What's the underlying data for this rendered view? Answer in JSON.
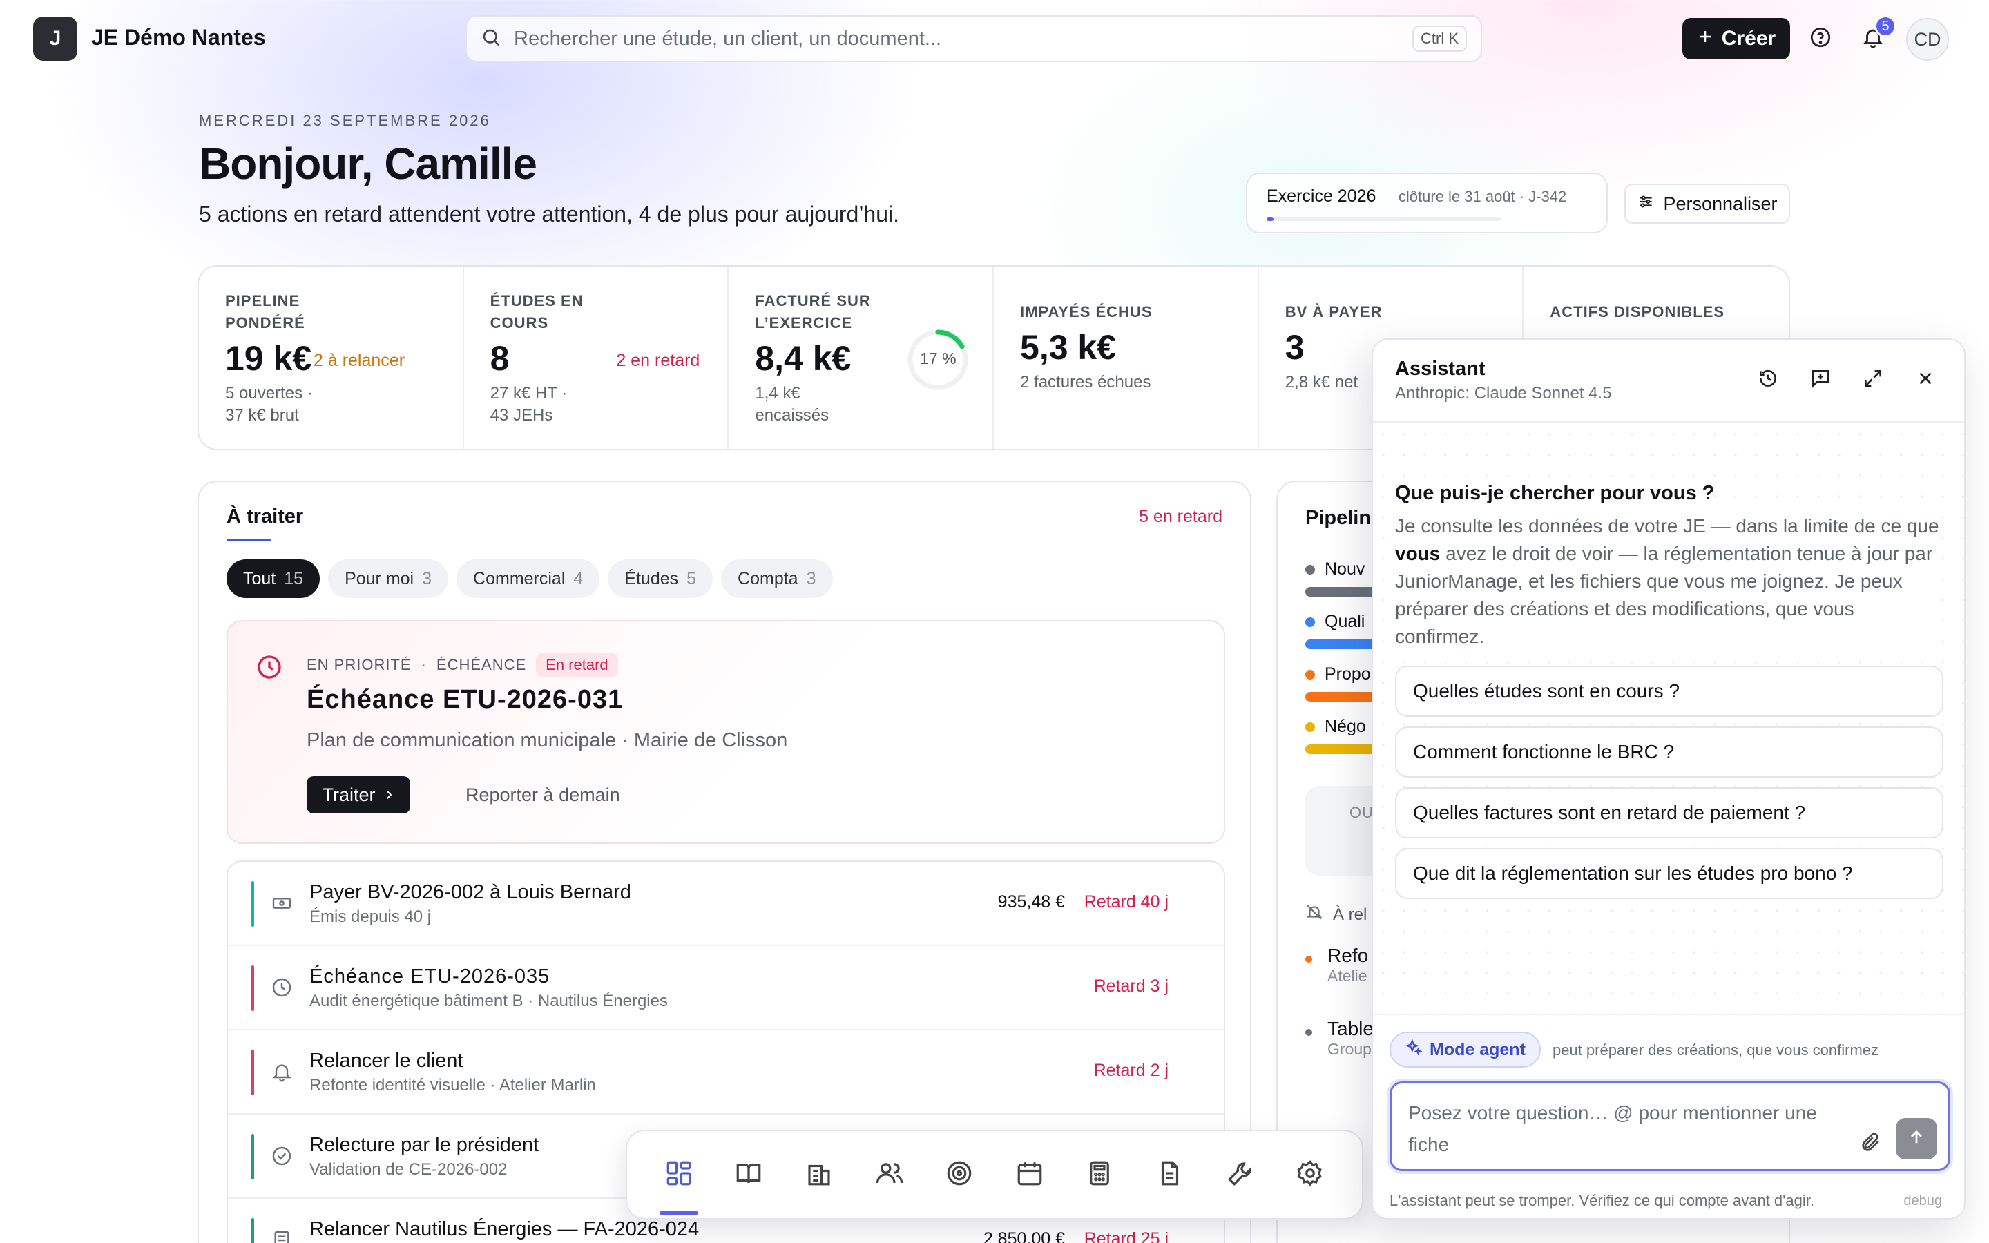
{
  "topbar": {
    "logo_letter": "J",
    "org_name": "JE Démo Nantes",
    "search_placeholder": "Rechercher une étude, un client, un document...",
    "search_shortcut": "Ctrl K",
    "create_label": "Créer",
    "notifications_count": "5",
    "avatar_initials": "CD"
  },
  "header": {
    "date": "MERCREDI 23 SEPTEMBRE 2026",
    "greeting": "Bonjour, Camille",
    "subtitle": "5 actions en retard attendent votre attention, 4 de plus pour aujourd’hui.",
    "exercice_label": "Exercice 2026",
    "exercice_close": "clôture le 31 août · J-342",
    "exercice_progress": 0.03,
    "customize_label": "Personnaliser"
  },
  "kpis": [
    {
      "label": "PIPELINE PONDÉRÉ",
      "value": "19 k€",
      "tag": "2 à relancer",
      "note": "5 ouvertes · 37 k€ brut"
    },
    {
      "label": "ÉTUDES EN COURS",
      "value": "8",
      "tag": "2 en retard",
      "note": "27 k€ HT · 43 JEHs"
    },
    {
      "label": "FACTURÉ SUR L’EXERCICE",
      "value": "8,4 k€",
      "tag": "17 %",
      "note": "1,4 k€ encaissés",
      "progress": 0.17
    },
    {
      "label": "IMPAYÉS ÉCHUS",
      "value": "5,3 k€",
      "tag": "2 factures échues",
      "note": ""
    },
    {
      "label": "BV À PAYER",
      "value": "3",
      "tag": "",
      "note": "2,8 k€ net"
    },
    {
      "label": "ACTIFS DISPONIBLES",
      "value": "",
      "tag": "",
      "note": ""
    }
  ],
  "todo": {
    "title": "À traiter",
    "late": "5 en retard",
    "filters": [
      {
        "label": "Tout",
        "count": "15"
      },
      {
        "label": "Pour moi",
        "count": "3"
      },
      {
        "label": "Commercial",
        "count": "4"
      },
      {
        "label": "Études",
        "count": "5"
      },
      {
        "label": "Compta",
        "count": "3"
      }
    ],
    "priority": {
      "kicker1": "EN PRIORITÉ",
      "kicker2": "ÉCHÉANCE",
      "chip": "En retard",
      "title": "Échéance ETU-2026-031",
      "desc": "Plan de communication municipale · Mairie de Clisson",
      "action": "Traiter",
      "postpone": "Reporter à demain"
    },
    "rows": [
      {
        "title": "Payer BV-2026-002 à Louis Bernard",
        "sub": "Émis depuis 40 j",
        "amount": "935,48 €",
        "delay": "Retard 40 j",
        "icon": "banknote-icon",
        "color": "#17b3a3"
      },
      {
        "title": "Échéance ETU-2026-035",
        "sub": "Audit énergétique bâtiment B · Nautilus Énergies",
        "amount": "",
        "delay": "Retard 3 j",
        "icon": "clock-icon",
        "color": "#e0405f"
      },
      {
        "title": "Relancer le client",
        "sub": "Refonte identité visuelle · Atelier Marlin",
        "amount": "",
        "delay": "Retard 2 j",
        "icon": "bell-icon",
        "color": "#e0405f"
      },
      {
        "title": "Relecture par le président",
        "sub": "Validation de CE-2026-002",
        "amount": "",
        "delay": "",
        "icon": "check-circle-icon",
        "color": "#22a06b"
      },
      {
        "title": "Relancer Nautilus Énergies — FA-2026-024",
        "sub": "",
        "amount": "2 850,00 €",
        "delay": "Retard 25 j",
        "icon": "invoice-icon",
        "color": "#22a06b"
      }
    ]
  },
  "pipeline": {
    "title": "Pipeline",
    "stages": [
      {
        "label": "Nouv",
        "color": "#6b6f78"
      },
      {
        "label": "Quali",
        "color": "#3b82f6"
      },
      {
        "label": "Propo",
        "color": "#f97316"
      },
      {
        "label": "Négo",
        "color": "#eab308"
      }
    ],
    "ou_label": "OU",
    "remind_label": "À rel",
    "items": [
      {
        "title": "Refo",
        "sub": "Atelie",
        "color": "#f97316"
      },
      {
        "title": "Table",
        "sub": "Group",
        "color": "#6b6f78"
      }
    ]
  },
  "dock": [
    "dashboard-icon",
    "book-icon",
    "building-icon",
    "users-icon",
    "target-icon",
    "calendar-icon",
    "calculator-icon",
    "document-icon",
    "wrench-icon",
    "settings-icon"
  ],
  "assistant": {
    "title": "Assistant",
    "model": "Anthropic: Claude Sonnet 4.5",
    "question": "Que puis-je chercher pour vous ?",
    "intro_a": "Je consulte les données de votre JE — dans la limite de ce que ",
    "intro_b": "vous",
    "intro_c": " avez le droit de voir — la réglementation tenue à jour par JuniorManage, et les fichiers que vous me joignez. Je peux préparer des créations et des modifications, que vous confirmez.",
    "suggestions": [
      "Quelles études sont en cours ?",
      "Comment fonctionne le BRC ?",
      "Quelles factures sont en retard de paiement ?",
      "Que dit la réglementation sur les études pro bono ?"
    ],
    "mode_label": "Mode agent",
    "mode_note": "peut préparer des créations, que vous confirmez",
    "composer_placeholder": "Posez votre question…  @ pour mentionner une fiche",
    "disclaimer": "L'assistant peut se tromper. Vérifiez ce qui compte avant d'agir.",
    "debug": "debug"
  }
}
